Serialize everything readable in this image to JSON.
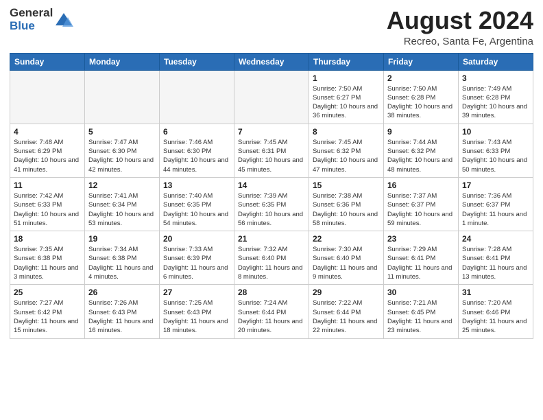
{
  "logo": {
    "general": "General",
    "blue": "Blue"
  },
  "title": "August 2024",
  "subtitle": "Recreo, Santa Fe, Argentina",
  "days_of_week": [
    "Sunday",
    "Monday",
    "Tuesday",
    "Wednesday",
    "Thursday",
    "Friday",
    "Saturday"
  ],
  "weeks": [
    [
      {
        "day": "",
        "empty": true
      },
      {
        "day": "",
        "empty": true
      },
      {
        "day": "",
        "empty": true
      },
      {
        "day": "",
        "empty": true
      },
      {
        "day": "1",
        "sunrise": "7:50 AM",
        "sunset": "6:27 PM",
        "daylight": "10 hours and 36 minutes."
      },
      {
        "day": "2",
        "sunrise": "7:50 AM",
        "sunset": "6:28 PM",
        "daylight": "10 hours and 38 minutes."
      },
      {
        "day": "3",
        "sunrise": "7:49 AM",
        "sunset": "6:28 PM",
        "daylight": "10 hours and 39 minutes."
      }
    ],
    [
      {
        "day": "4",
        "sunrise": "7:48 AM",
        "sunset": "6:29 PM",
        "daylight": "10 hours and 41 minutes."
      },
      {
        "day": "5",
        "sunrise": "7:47 AM",
        "sunset": "6:30 PM",
        "daylight": "10 hours and 42 minutes."
      },
      {
        "day": "6",
        "sunrise": "7:46 AM",
        "sunset": "6:30 PM",
        "daylight": "10 hours and 44 minutes."
      },
      {
        "day": "7",
        "sunrise": "7:45 AM",
        "sunset": "6:31 PM",
        "daylight": "10 hours and 45 minutes."
      },
      {
        "day": "8",
        "sunrise": "7:45 AM",
        "sunset": "6:32 PM",
        "daylight": "10 hours and 47 minutes."
      },
      {
        "day": "9",
        "sunrise": "7:44 AM",
        "sunset": "6:32 PM",
        "daylight": "10 hours and 48 minutes."
      },
      {
        "day": "10",
        "sunrise": "7:43 AM",
        "sunset": "6:33 PM",
        "daylight": "10 hours and 50 minutes."
      }
    ],
    [
      {
        "day": "11",
        "sunrise": "7:42 AM",
        "sunset": "6:33 PM",
        "daylight": "10 hours and 51 minutes."
      },
      {
        "day": "12",
        "sunrise": "7:41 AM",
        "sunset": "6:34 PM",
        "daylight": "10 hours and 53 minutes."
      },
      {
        "day": "13",
        "sunrise": "7:40 AM",
        "sunset": "6:35 PM",
        "daylight": "10 hours and 54 minutes."
      },
      {
        "day": "14",
        "sunrise": "7:39 AM",
        "sunset": "6:35 PM",
        "daylight": "10 hours and 56 minutes."
      },
      {
        "day": "15",
        "sunrise": "7:38 AM",
        "sunset": "6:36 PM",
        "daylight": "10 hours and 58 minutes."
      },
      {
        "day": "16",
        "sunrise": "7:37 AM",
        "sunset": "6:37 PM",
        "daylight": "10 hours and 59 minutes."
      },
      {
        "day": "17",
        "sunrise": "7:36 AM",
        "sunset": "6:37 PM",
        "daylight": "11 hours and 1 minute."
      }
    ],
    [
      {
        "day": "18",
        "sunrise": "7:35 AM",
        "sunset": "6:38 PM",
        "daylight": "11 hours and 3 minutes."
      },
      {
        "day": "19",
        "sunrise": "7:34 AM",
        "sunset": "6:38 PM",
        "daylight": "11 hours and 4 minutes."
      },
      {
        "day": "20",
        "sunrise": "7:33 AM",
        "sunset": "6:39 PM",
        "daylight": "11 hours and 6 minutes."
      },
      {
        "day": "21",
        "sunrise": "7:32 AM",
        "sunset": "6:40 PM",
        "daylight": "11 hours and 8 minutes."
      },
      {
        "day": "22",
        "sunrise": "7:30 AM",
        "sunset": "6:40 PM",
        "daylight": "11 hours and 9 minutes."
      },
      {
        "day": "23",
        "sunrise": "7:29 AM",
        "sunset": "6:41 PM",
        "daylight": "11 hours and 11 minutes."
      },
      {
        "day": "24",
        "sunrise": "7:28 AM",
        "sunset": "6:41 PM",
        "daylight": "11 hours and 13 minutes."
      }
    ],
    [
      {
        "day": "25",
        "sunrise": "7:27 AM",
        "sunset": "6:42 PM",
        "daylight": "11 hours and 15 minutes."
      },
      {
        "day": "26",
        "sunrise": "7:26 AM",
        "sunset": "6:43 PM",
        "daylight": "11 hours and 16 minutes."
      },
      {
        "day": "27",
        "sunrise": "7:25 AM",
        "sunset": "6:43 PM",
        "daylight": "11 hours and 18 minutes."
      },
      {
        "day": "28",
        "sunrise": "7:24 AM",
        "sunset": "6:44 PM",
        "daylight": "11 hours and 20 minutes."
      },
      {
        "day": "29",
        "sunrise": "7:22 AM",
        "sunset": "6:44 PM",
        "daylight": "11 hours and 22 minutes."
      },
      {
        "day": "30",
        "sunrise": "7:21 AM",
        "sunset": "6:45 PM",
        "daylight": "11 hours and 23 minutes."
      },
      {
        "day": "31",
        "sunrise": "7:20 AM",
        "sunset": "6:46 PM",
        "daylight": "11 hours and 25 minutes."
      }
    ]
  ]
}
